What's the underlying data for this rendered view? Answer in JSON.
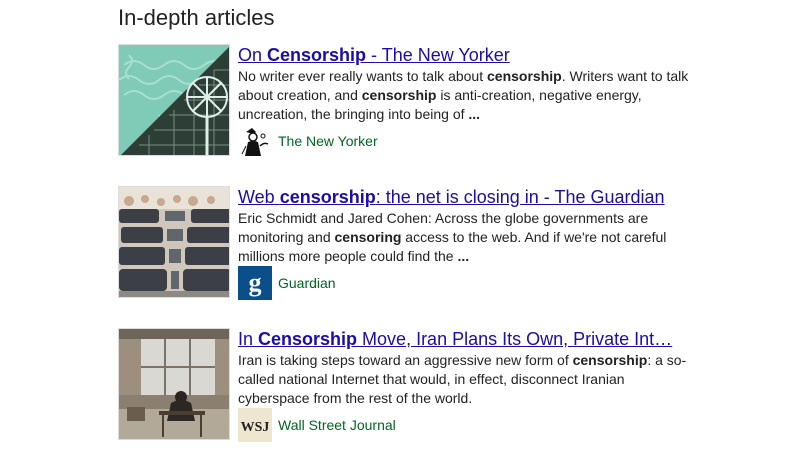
{
  "section": {
    "title": "In-depth articles"
  },
  "articles": [
    {
      "title_prefix": "On ",
      "title_bold": "Censorship",
      "title_suffix": " - The New Yorker",
      "snippet": [
        {
          "t": "No writer ever really wants to talk about ",
          "b": false
        },
        {
          "t": "censorship",
          "b": true
        },
        {
          "t": ". Writers want to talk about creation, and ",
          "b": false
        },
        {
          "t": "censorship",
          "b": true
        },
        {
          "t": " is anti-creation, negative energy, uncreation, the bringing into being of ",
          "b": false
        },
        {
          "t": "...",
          "b": true
        }
      ],
      "source": "The New Yorker",
      "thumb_icon": "windmill-illustration-thumbnail",
      "logo_icon": "eustace-tilley-logo-icon"
    },
    {
      "title_prefix": "Web ",
      "title_bold": "censorship",
      "title_suffix": ": the net is closing in - The Guardian",
      "snippet": [
        {
          "t": "Eric Schmidt and Jared Cohen: Across the globe governments are monitoring and ",
          "b": false
        },
        {
          "t": "censoring",
          "b": true
        },
        {
          "t": " access to the web. And if we're not careful millions more people could find the ",
          "b": false
        },
        {
          "t": "...",
          "b": true
        }
      ],
      "source": "Guardian",
      "thumb_icon": "internet-cafe-photo-thumbnail",
      "logo_icon": "guardian-g-logo-icon"
    },
    {
      "title_prefix": "In ",
      "title_bold": "Censorship",
      "title_suffix": " Move, Iran Plans Its Own, Private Int…",
      "snippet": [
        {
          "t": "Iran is taking steps toward an aggressive new form of ",
          "b": false
        },
        {
          "t": "censorship",
          "b": true
        },
        {
          "t": ": a so-called national Internet that would, in effect, disconnect Iranian cyberspace from the rest of the world.",
          "b": false
        }
      ],
      "source": "Wall Street Journal",
      "thumb_icon": "man-at-desk-photo-thumbnail",
      "logo_icon": "wsj-logo-icon"
    }
  ],
  "colors": {
    "link": "#1a0dab",
    "source": "#006621",
    "text": "#222222"
  }
}
